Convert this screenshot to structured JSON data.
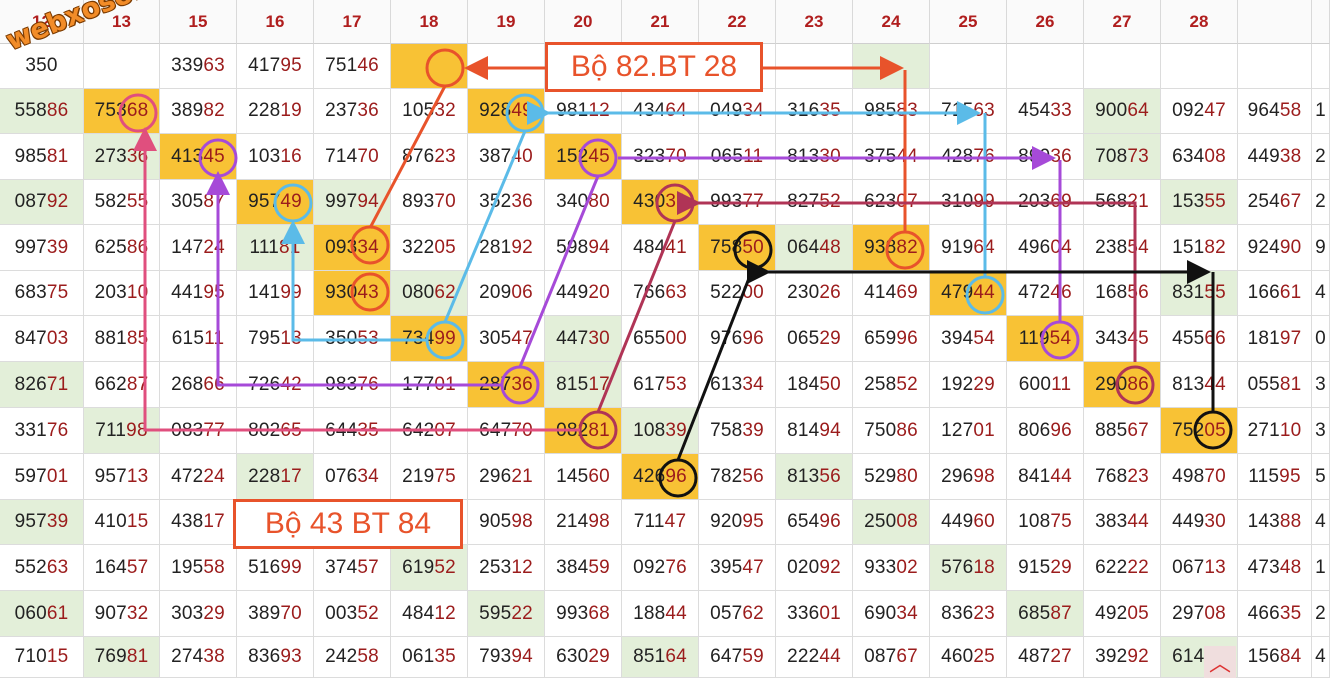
{
  "logo_text": "webxoso.net",
  "labels": {
    "bo82": "Bộ 82.BT 28",
    "bo43": "Bộ 43 BT 84"
  },
  "scroll_top_icon": "chevron-up-icon",
  "colors": {
    "header_text": "#b01e1e",
    "tail_digits": "#9b1c1c",
    "green_cell": "#e3efd9",
    "orange_cell": "#f8c235",
    "orange": "#e8532b",
    "blue": "#5bbbe8",
    "purple": "#a64ad8",
    "crimson": "#b03456",
    "pink": "#e04f7e",
    "black": "#111111"
  },
  "headers": [
    "12",
    "13",
    "15",
    "16",
    "17",
    "18",
    "19",
    "20",
    "21",
    "22",
    "23",
    "24",
    "25",
    "26",
    "27",
    "28",
    ""
  ],
  "rows": [
    [
      "350",
      "",
      "33963",
      "41795",
      "75146",
      "",
      "",
      "",
      "",
      "",
      "",
      "",
      "",
      "",
      "",
      "",
      ""
    ],
    [
      "55886",
      "75368",
      "38982",
      "22819",
      "23736",
      "10532",
      "92849",
      "98112",
      "43464",
      "04934",
      "31635",
      "98583",
      "71563",
      "45433",
      "90064",
      "09247",
      "96458"
    ],
    [
      "98581",
      "27336",
      "41345",
      "10316",
      "71470",
      "87623",
      "38740",
      "15245",
      "32370",
      "06511",
      "81330",
      "37544",
      "42876",
      "89936",
      "70873",
      "63408",
      "44938"
    ],
    [
      "08792",
      "58255",
      "30587",
      "95749",
      "99794",
      "89370",
      "35236",
      "34080",
      "43031",
      "99377",
      "82752",
      "62307",
      "31099",
      "20369",
      "56821",
      "15355",
      "25467"
    ],
    [
      "99739",
      "62586",
      "14724",
      "11181",
      "09334",
      "32205",
      "28192",
      "59894",
      "48441",
      "75850",
      "06448",
      "93882",
      "91964",
      "49604",
      "23854",
      "15182",
      "92490"
    ],
    [
      "68375",
      "20310",
      "44195",
      "14199",
      "93043",
      "08062",
      "20906",
      "44920",
      "76663",
      "52200",
      "23026",
      "41469",
      "47944",
      "47246",
      "16856",
      "83155",
      "16661"
    ],
    [
      "84703",
      "88185",
      "61511",
      "79513",
      "35053",
      "73499",
      "30547",
      "44730",
      "65500",
      "97696",
      "06529",
      "65996",
      "39454",
      "11954",
      "34345",
      "45566",
      "18197"
    ],
    [
      "82671",
      "66287",
      "26866",
      "72642",
      "98376",
      "17701",
      "28736",
      "81517",
      "61753",
      "61334",
      "18450",
      "25852",
      "19229",
      "60011",
      "29086",
      "81344",
      "05581"
    ],
    [
      "33176",
      "71198",
      "08377",
      "80265",
      "64435",
      "64207",
      "64770",
      "08281",
      "10839",
      "75839",
      "81494",
      "75086",
      "12701",
      "80696",
      "88567",
      "75205",
      "27110"
    ],
    [
      "59701",
      "95713",
      "47224",
      "22817",
      "07634",
      "21975",
      "29621",
      "14560",
      "42696",
      "78256",
      "81356",
      "52980",
      "29698",
      "84144",
      "76823",
      "49870",
      "11595"
    ],
    [
      "95739",
      "41015",
      "43817",
      "",
      "",
      "",
      "90598",
      "21498",
      "71147",
      "92095",
      "65496",
      "25008",
      "44960",
      "10875",
      "38344",
      "44930",
      "14388"
    ],
    [
      "55263",
      "16457",
      "19558",
      "51699",
      "37457",
      "61952",
      "25312",
      "38459",
      "09276",
      "39547",
      "02092",
      "93302",
      "57618",
      "91529",
      "62222",
      "06713",
      "47348"
    ],
    [
      "06061",
      "90732",
      "30329",
      "38970",
      "00352",
      "48412",
      "59522",
      "99368",
      "18844",
      "05762",
      "33601",
      "69034",
      "83623",
      "68587",
      "49205",
      "29708",
      "46635"
    ],
    [
      "71015",
      "76981",
      "27438",
      "83693",
      "24258",
      "06135",
      "79394",
      "63029",
      "85164",
      "64759",
      "22244",
      "08767",
      "46025",
      "48727",
      "39292",
      "61412",
      "15684"
    ]
  ],
  "last_col_peek": [
    "",
    "1",
    "2",
    "2",
    "9",
    "4",
    "0",
    "3",
    "3",
    "5",
    "4",
    "1",
    "2",
    "4"
  ],
  "green_cells": [
    [
      0,
      11
    ],
    [
      1,
      0
    ],
    [
      1,
      14
    ],
    [
      2,
      1
    ],
    [
      2,
      14
    ],
    [
      3,
      15
    ],
    [
      3,
      4
    ],
    [
      4,
      3
    ],
    [
      4,
      10
    ],
    [
      5,
      5
    ],
    [
      5,
      15
    ],
    [
      6,
      7
    ],
    [
      7,
      0
    ],
    [
      8,
      1
    ],
    [
      8,
      8
    ],
    [
      9,
      3
    ],
    [
      9,
      10
    ],
    [
      10,
      11
    ],
    [
      11,
      5
    ],
    [
      11,
      12
    ],
    [
      12,
      6
    ],
    [
      12,
      13
    ],
    [
      13,
      1
    ],
    [
      13,
      8
    ],
    [
      13,
      15
    ],
    [
      7,
      7
    ],
    [
      3,
      0
    ],
    [
      10,
      0
    ],
    [
      12,
      0
    ]
  ],
  "orange_cells": [
    [
      0,
      5
    ],
    [
      1,
      1
    ],
    [
      1,
      6
    ],
    [
      2,
      2
    ],
    [
      2,
      7
    ],
    [
      3,
      3
    ],
    [
      3,
      8
    ],
    [
      4,
      4
    ],
    [
      4,
      9
    ],
    [
      4,
      11
    ],
    [
      5,
      4
    ],
    [
      5,
      12
    ],
    [
      6,
      5
    ],
    [
      6,
      13
    ],
    [
      7,
      6
    ],
    [
      7,
      14
    ],
    [
      8,
      7
    ],
    [
      8,
      15
    ],
    [
      9,
      8
    ]
  ]
}
